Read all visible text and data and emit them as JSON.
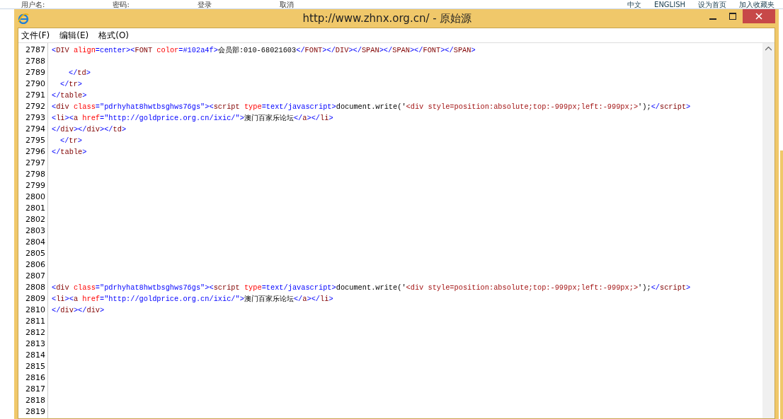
{
  "background_page": {
    "left_links": [
      "用户名:",
      "密码:",
      "登录",
      "取消"
    ],
    "right_links": [
      "中文",
      "ENGLISH",
      "设为首页",
      "加入收藏夹"
    ]
  },
  "window": {
    "title": "http://www.zhnx.org.cn/ - 原始源"
  },
  "menu": [
    "文件(F)",
    "编辑(E)",
    "格式(O)"
  ],
  "source_lines": [
    {
      "number": "2787",
      "segments": [
        {
          "kind": "bracket",
          "text": "<"
        },
        {
          "kind": "tag",
          "text": "DIV"
        },
        {
          "kind": "attr",
          "text": " align"
        },
        {
          "kind": "value",
          "text": "=center"
        },
        {
          "kind": "bracket",
          "text": ">"
        },
        {
          "kind": "bracket",
          "text": "<"
        },
        {
          "kind": "tag",
          "text": "FONT"
        },
        {
          "kind": "attr",
          "text": " color"
        },
        {
          "kind": "value",
          "text": "=#102a4f"
        },
        {
          "kind": "bracket",
          "text": ">"
        },
        {
          "kind": "text",
          "text": "会员部:010-68021603"
        },
        {
          "kind": "bracket",
          "text": "</"
        },
        {
          "kind": "tag",
          "text": "FONT"
        },
        {
          "kind": "bracket",
          "text": "></"
        },
        {
          "kind": "tag",
          "text": "DIV"
        },
        {
          "kind": "bracket",
          "text": "></"
        },
        {
          "kind": "tag",
          "text": "SPAN"
        },
        {
          "kind": "bracket",
          "text": "></"
        },
        {
          "kind": "tag",
          "text": "SPAN"
        },
        {
          "kind": "bracket",
          "text": "></"
        },
        {
          "kind": "tag",
          "text": "FONT"
        },
        {
          "kind": "bracket",
          "text": "></"
        },
        {
          "kind": "tag",
          "text": "SPAN"
        },
        {
          "kind": "bracket",
          "text": ">"
        }
      ]
    },
    {
      "number": "2788"
    },
    {
      "number": "2789",
      "kind": "deep",
      "segments": [
        {
          "kind": "bracket",
          "text": "</"
        },
        {
          "kind": "tag",
          "text": "td"
        },
        {
          "kind": "bracket",
          "text": ">"
        }
      ]
    },
    {
      "number": "2790",
      "kind": "shallow",
      "segments": [
        {
          "kind": "bracket",
          "text": "</"
        },
        {
          "kind": "tag",
          "text": "tr"
        },
        {
          "kind": "bracket",
          "text": ">"
        }
      ]
    },
    {
      "number": "2791",
      "segments": [
        {
          "kind": "bracket",
          "text": "</"
        },
        {
          "kind": "tag",
          "text": "table"
        },
        {
          "kind": "bracket",
          "text": ">"
        }
      ]
    },
    {
      "number": "2792",
      "segments": [
        {
          "kind": "bracket",
          "text": "<"
        },
        {
          "kind": "tag",
          "text": "div"
        },
        {
          "kind": "attr",
          "text": " class"
        },
        {
          "kind": "value",
          "text": "=\"pdrhyhat8hwtbsghws76gs\""
        },
        {
          "kind": "bracket",
          "text": "><"
        },
        {
          "kind": "tag",
          "text": "script"
        },
        {
          "kind": "attr",
          "text": " type"
        },
        {
          "kind": "value",
          "text": "=text/javascript"
        },
        {
          "kind": "bracket",
          "text": ">"
        },
        {
          "kind": "text",
          "text": "document.write('"
        },
        {
          "kind": "string",
          "text": "<div style=position:absolute;top:-999px;left:-999px;>"
        },
        {
          "kind": "text",
          "text": "');"
        },
        {
          "kind": "bracket",
          "text": "</"
        },
        {
          "kind": "tag",
          "text": "script"
        },
        {
          "kind": "bracket",
          "text": ">"
        }
      ]
    },
    {
      "number": "2793",
      "segments": [
        {
          "kind": "bracket",
          "text": "<"
        },
        {
          "kind": "tag",
          "text": "li"
        },
        {
          "kind": "bracket",
          "text": "><"
        },
        {
          "kind": "tag",
          "text": "a"
        },
        {
          "kind": "attr",
          "text": " href"
        },
        {
          "kind": "value",
          "text": "=\"http://goldprice.org.cn/ixic/\""
        },
        {
          "kind": "bracket",
          "text": ">"
        },
        {
          "kind": "text",
          "text": "澳门百家乐论坛"
        },
        {
          "kind": "bracket",
          "text": "</"
        },
        {
          "kind": "tag",
          "text": "a"
        },
        {
          "kind": "bracket",
          "text": "></"
        },
        {
          "kind": "tag",
          "text": "li"
        },
        {
          "kind": "bracket",
          "text": ">"
        }
      ]
    },
    {
      "number": "2794",
      "segments": [
        {
          "kind": "bracket",
          "text": "</"
        },
        {
          "kind": "tag",
          "text": "div"
        },
        {
          "kind": "bracket",
          "text": "></"
        },
        {
          "kind": "tag",
          "text": "div"
        },
        {
          "kind": "bracket",
          "text": "></"
        },
        {
          "kind": "tag",
          "text": "td"
        },
        {
          "kind": "bracket",
          "text": ">"
        }
      ]
    },
    {
      "number": "2795",
      "kind": "shallow",
      "segments": [
        {
          "kind": "bracket",
          "text": "</"
        },
        {
          "kind": "tag",
          "text": "tr"
        },
        {
          "kind": "bracket",
          "text": ">"
        }
      ]
    },
    {
      "number": "2796",
      "segments": [
        {
          "kind": "bracket",
          "text": "</"
        },
        {
          "kind": "tag",
          "text": "table"
        },
        {
          "kind": "bracket",
          "text": ">"
        }
      ]
    },
    {
      "number": "2797"
    },
    {
      "number": "2798"
    },
    {
      "number": "2799"
    },
    {
      "number": "2800"
    },
    {
      "number": "2801"
    },
    {
      "number": "2802"
    },
    {
      "number": "2803"
    },
    {
      "number": "2804"
    },
    {
      "number": "2805"
    },
    {
      "number": "2806"
    },
    {
      "number": "2807"
    },
    {
      "number": "2808",
      "segments": [
        {
          "kind": "bracket",
          "text": "<"
        },
        {
          "kind": "tag",
          "text": "div"
        },
        {
          "kind": "attr",
          "text": " class"
        },
        {
          "kind": "value",
          "text": "=\"pdrhyhat8hwtbsghws76gs\""
        },
        {
          "kind": "bracket",
          "text": "><"
        },
        {
          "kind": "tag",
          "text": "script"
        },
        {
          "kind": "attr",
          "text": " type"
        },
        {
          "kind": "value",
          "text": "=text/javascript"
        },
        {
          "kind": "bracket",
          "text": ">"
        },
        {
          "kind": "text",
          "text": "document.write('"
        },
        {
          "kind": "string",
          "text": "<div style=position:absolute;top:-999px;left:-999px;>"
        },
        {
          "kind": "text",
          "text": "');"
        },
        {
          "kind": "bracket",
          "text": "</"
        },
        {
          "kind": "tag",
          "text": "script"
        },
        {
          "kind": "bracket",
          "text": ">"
        }
      ]
    },
    {
      "number": "2809",
      "segments": [
        {
          "kind": "bracket",
          "text": "<"
        },
        {
          "kind": "tag",
          "text": "li"
        },
        {
          "kind": "bracket",
          "text": "><"
        },
        {
          "kind": "tag",
          "text": "a"
        },
        {
          "kind": "attr",
          "text": " href"
        },
        {
          "kind": "value",
          "text": "=\"http://goldprice.org.cn/ixic/\""
        },
        {
          "kind": "bracket",
          "text": ">"
        },
        {
          "kind": "text",
          "text": "澳门百家乐论坛"
        },
        {
          "kind": "bracket",
          "text": "</"
        },
        {
          "kind": "tag",
          "text": "a"
        },
        {
          "kind": "bracket",
          "text": "></"
        },
        {
          "kind": "tag",
          "text": "li"
        },
        {
          "kind": "bracket",
          "text": ">"
        }
      ]
    },
    {
      "number": "2810",
      "segments": [
        {
          "kind": "bracket",
          "text": "</"
        },
        {
          "kind": "tag",
          "text": "div"
        },
        {
          "kind": "bracket",
          "text": "></"
        },
        {
          "kind": "tag",
          "text": "div"
        },
        {
          "kind": "bracket",
          "text": ">"
        }
      ]
    },
    {
      "number": "2811"
    },
    {
      "number": "2812"
    },
    {
      "number": "2813"
    },
    {
      "number": "2814"
    },
    {
      "number": "2815"
    },
    {
      "number": "2816"
    },
    {
      "number": "2817"
    },
    {
      "number": "2818"
    },
    {
      "number": "2819"
    }
  ]
}
